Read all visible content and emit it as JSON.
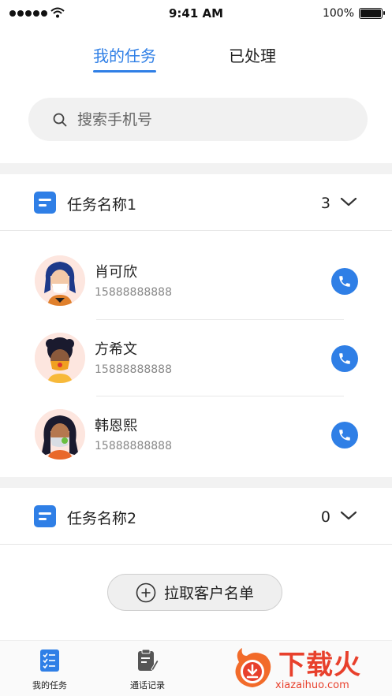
{
  "status_bar": {
    "time": "9:41 AM",
    "battery": "100%"
  },
  "tabs": [
    {
      "label": "我的任务",
      "active": true
    },
    {
      "label": "已处理",
      "active": false
    }
  ],
  "search": {
    "placeholder": "搜索手机号"
  },
  "groups": [
    {
      "title": "任务名称1",
      "count": "3",
      "contacts": [
        {
          "name": "肖可欣",
          "phone": "15888888888"
        },
        {
          "name": "方希文",
          "phone": "15888888888"
        },
        {
          "name": "韩恩熙",
          "phone": "15888888888"
        }
      ]
    },
    {
      "title": "任务名称2",
      "count": "0",
      "contacts": []
    }
  ],
  "pull_button": {
    "label": "拉取客户名单"
  },
  "bottom_nav": [
    {
      "label": "我的任务",
      "icon": "task-list-icon"
    },
    {
      "label": "通话记录",
      "icon": "call-record-icon"
    }
  ],
  "watermark": {
    "text": "下载火",
    "sub": "xiazaihuo.com"
  },
  "colors": {
    "accent": "#2f7fe6",
    "watermark": "#e8402c"
  }
}
